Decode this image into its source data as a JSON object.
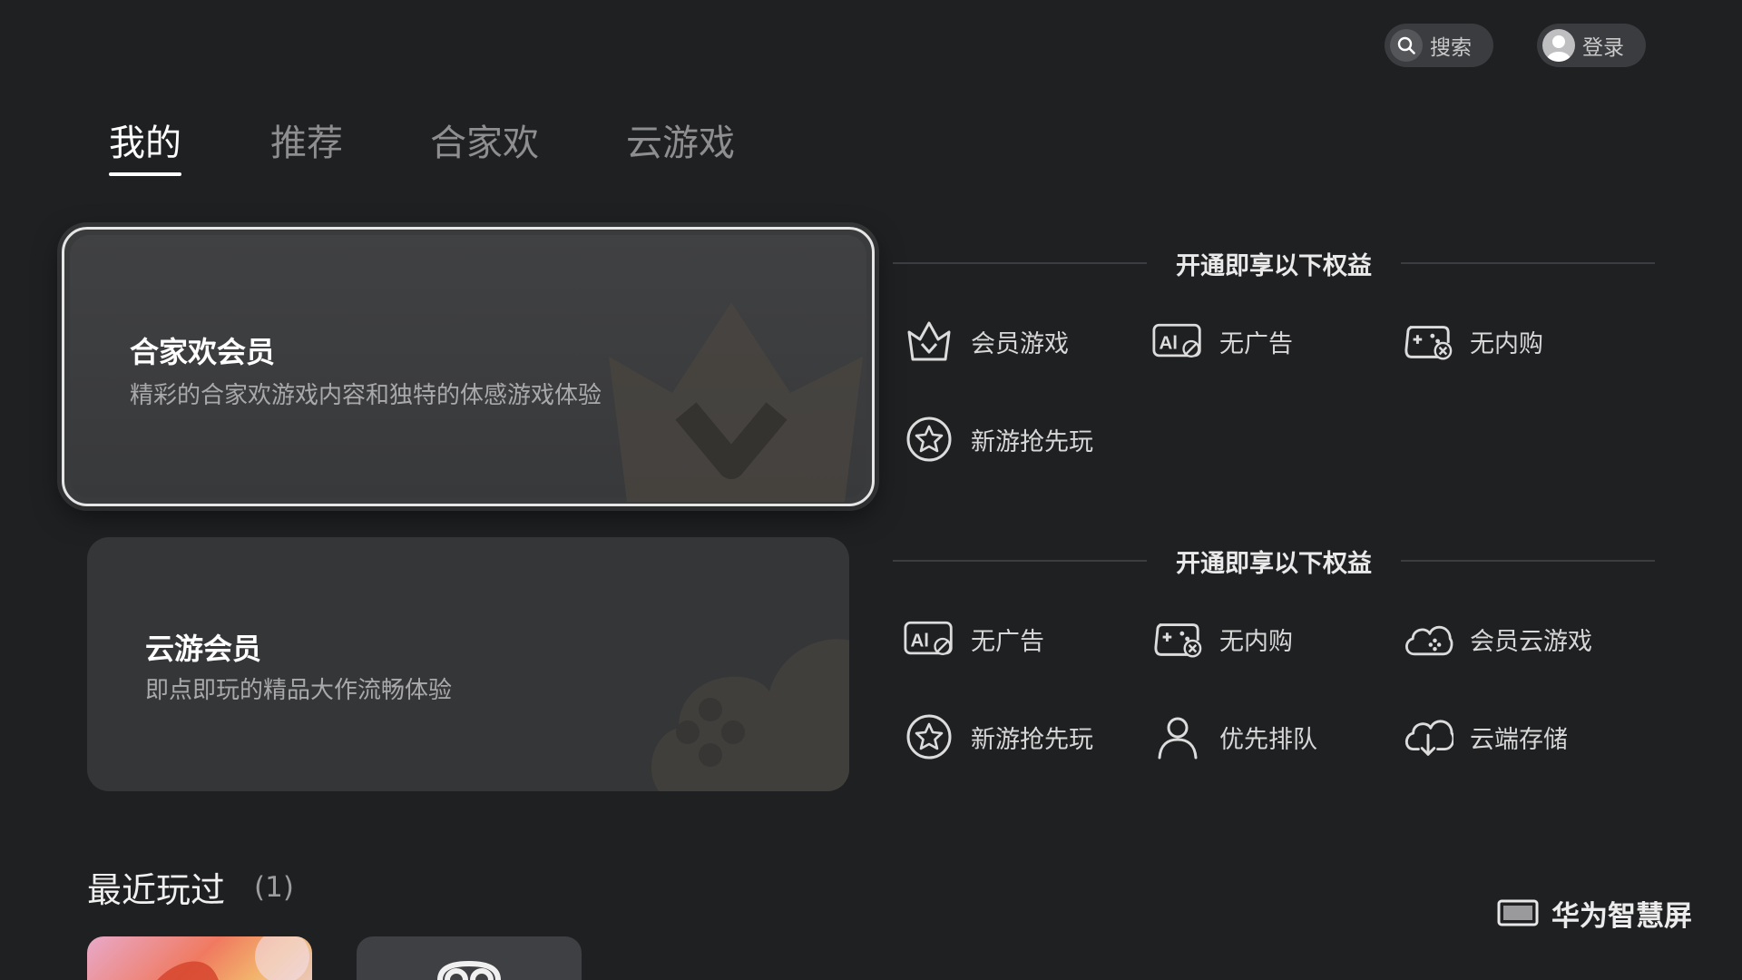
{
  "header": {
    "search_label": "搜索",
    "login_label": "登录",
    "icons": {
      "search": "search-icon",
      "avatar": "avatar-icon"
    }
  },
  "tabs": [
    {
      "label": "我的",
      "active": true
    },
    {
      "label": "推荐",
      "active": false
    },
    {
      "label": "合家欢",
      "active": false
    },
    {
      "label": "云游戏",
      "active": false
    }
  ],
  "cards": [
    {
      "title": "合家欢会员",
      "desc": "精彩的合家欢游戏内容和独特的体感游戏体验",
      "deco": "crown-icon",
      "focused": true
    },
    {
      "title": "云游会员",
      "desc": "即点即玩的精品大作流畅体验",
      "deco": "cloud-gamepad-icon",
      "focused": false
    }
  ],
  "benefits": [
    {
      "heading": "开通即享以下权益",
      "items": [
        {
          "label": "会员游戏",
          "icon": "crown-icon"
        },
        {
          "label": "无广告",
          "icon": "no-ad-icon"
        },
        {
          "label": "无内购",
          "icon": "no-purchase-gamepad-icon"
        },
        {
          "label": "新游抢先玩",
          "icon": "star-circle-icon"
        }
      ]
    },
    {
      "heading": "开通即享以下权益",
      "items": [
        {
          "label": "无广告",
          "icon": "no-ad-icon"
        },
        {
          "label": "无内购",
          "icon": "no-purchase-gamepad-icon"
        },
        {
          "label": "会员云游戏",
          "icon": "cloud-gamepad-icon"
        },
        {
          "label": "新游抢先玩",
          "icon": "star-circle-icon"
        },
        {
          "label": "优先排队",
          "icon": "person-icon"
        },
        {
          "label": "云端存储",
          "icon": "cloud-download-icon"
        }
      ]
    }
  ],
  "recent": {
    "title": "最近玩过",
    "count": "(1)"
  },
  "brand": {
    "label": "华为智慧屏",
    "icon": "tv-icon"
  },
  "colors": {
    "background": "#1f2022",
    "card": "#353638",
    "focus_border": "#e6e6e6",
    "accent_deco": "#4a4640"
  }
}
